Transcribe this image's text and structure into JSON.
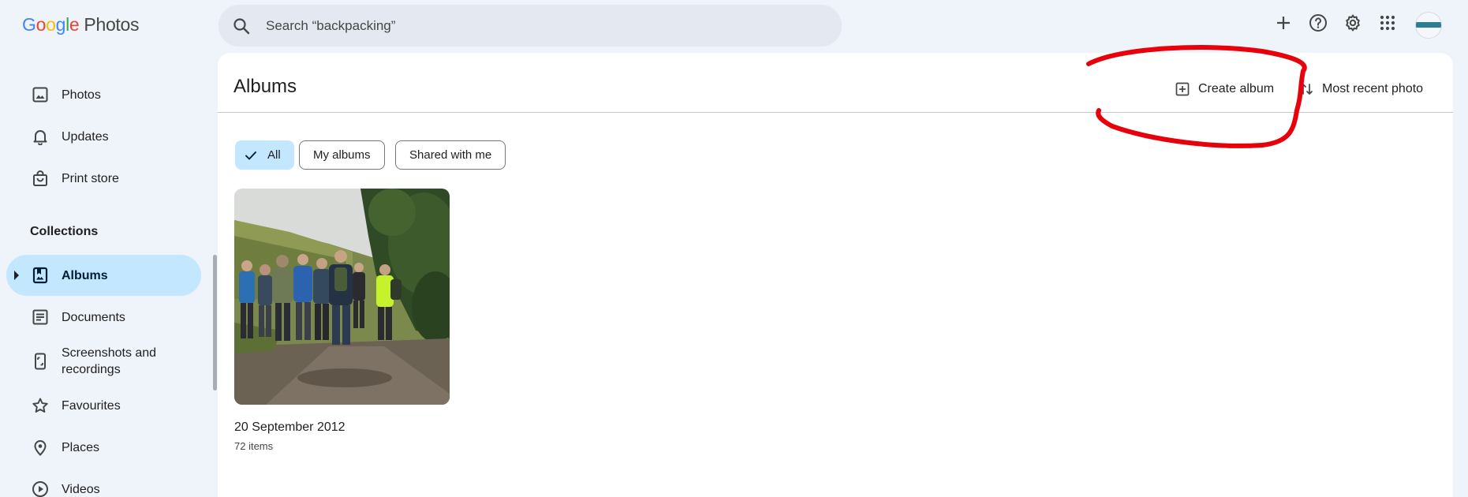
{
  "app": {
    "logo_brand": "Google",
    "logo_product": "Photos"
  },
  "search": {
    "placeholder": "Search “backpacking”",
    "icon": "search-icon"
  },
  "top_actions": [
    {
      "name": "add-icon"
    },
    {
      "name": "help-icon"
    },
    {
      "name": "settings-icon"
    },
    {
      "name": "apps-grid-icon"
    }
  ],
  "sidebar": {
    "items": [
      {
        "label": "Photos",
        "icon": "photo-icon"
      },
      {
        "label": "Updates",
        "icon": "bell-icon"
      },
      {
        "label": "Print store",
        "icon": "shopping-bag-icon"
      }
    ],
    "section_title": "Collections",
    "collections": [
      {
        "label": "Albums",
        "icon": "album-icon",
        "active": true
      },
      {
        "label": "Documents",
        "icon": "document-icon"
      },
      {
        "label": "Screenshots and recordings",
        "icon": "phone-screenshot-icon"
      },
      {
        "label": "Favourites",
        "icon": "star-icon"
      },
      {
        "label": "Places",
        "icon": "location-pin-icon"
      },
      {
        "label": "Videos",
        "icon": "play-circle-icon"
      }
    ]
  },
  "main": {
    "title": "Albums",
    "create_album_label": "Create album",
    "sort_label": "Most recent photo",
    "filters": [
      {
        "label": "All",
        "selected": true
      },
      {
        "label": "My albums",
        "selected": false
      },
      {
        "label": "Shared with me",
        "selected": false
      }
    ],
    "albums": [
      {
        "title": "20 September 2012",
        "count": "72 items"
      }
    ]
  },
  "colors": {
    "background": "#eff3fa",
    "surface": "#ffffff",
    "active_pill": "#c2e7ff",
    "annotation_red": "#e8000b"
  }
}
